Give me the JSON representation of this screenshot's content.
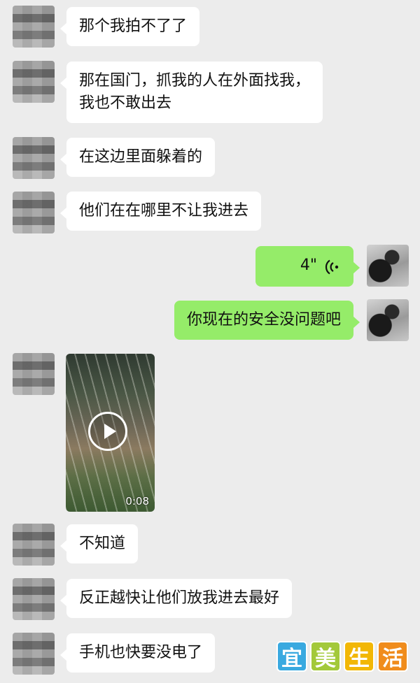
{
  "messages": [
    {
      "side": "left",
      "type": "text",
      "lines": [
        "那个我拍不了了"
      ]
    },
    {
      "side": "left",
      "type": "text",
      "lines": [
        "那在国门，抓我的人在外面找我，",
        "我也不敢出去"
      ]
    },
    {
      "side": "left",
      "type": "text",
      "lines": [
        "在这边里面躲着的"
      ]
    },
    {
      "side": "left",
      "type": "text",
      "lines": [
        "他们在在哪里不让我进去"
      ]
    },
    {
      "side": "right",
      "type": "voice",
      "duration": "4\"",
      "icon": "voice-wave-icon"
    },
    {
      "side": "right",
      "type": "text",
      "lines": [
        "你现在的安全没问题吧"
      ]
    },
    {
      "side": "left",
      "type": "video",
      "duration": "0:08",
      "icon": "play-icon"
    },
    {
      "side": "left",
      "type": "text",
      "lines": [
        "不知道"
      ]
    },
    {
      "side": "left",
      "type": "text",
      "lines": [
        "反正越快让他们放我进去最好"
      ]
    },
    {
      "side": "left",
      "type": "text",
      "lines": [
        "手机也快要没电了"
      ]
    }
  ],
  "watermark": {
    "chars": [
      "宜",
      "美",
      "生",
      "活"
    ],
    "colors": [
      "#39a9e0",
      "#a3c93a",
      "#f2b705",
      "#f08c1c"
    ]
  },
  "colors": {
    "background": "#ececec",
    "incoming_bubble": "#ffffff",
    "outgoing_bubble": "#95ec69"
  }
}
